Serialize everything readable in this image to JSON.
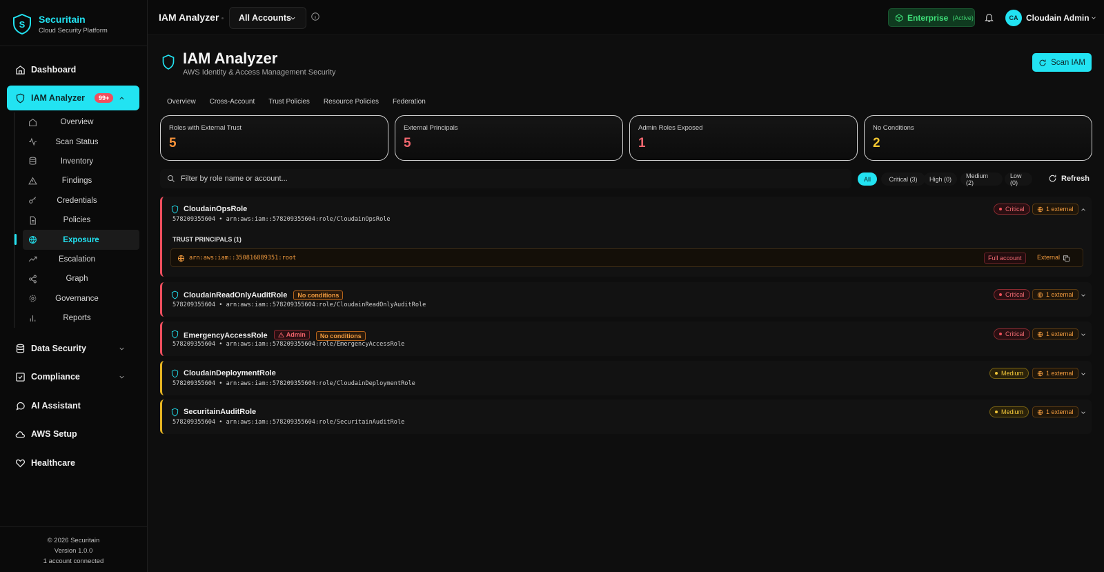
{
  "brand": {
    "name": "Securitain",
    "tagline": "Cloud Security Platform",
    "logo_letter": "S"
  },
  "sidebar": {
    "dashboard": "Dashboard",
    "iam": {
      "label": "IAM Analyzer",
      "badge": "99+"
    },
    "sub_items": [
      {
        "label": "Overview",
        "icon": "home-icon"
      },
      {
        "label": "Scan Status",
        "icon": "activity-icon"
      },
      {
        "label": "Inventory",
        "icon": "database-icon"
      },
      {
        "label": "Findings",
        "icon": "alert-triangle-icon"
      },
      {
        "label": "Credentials",
        "icon": "key-icon"
      },
      {
        "label": "Policies",
        "icon": "file-icon"
      },
      {
        "label": "Exposure",
        "icon": "globe-icon",
        "active": true
      },
      {
        "label": "Escalation",
        "icon": "trending-up-icon"
      },
      {
        "label": "Graph",
        "icon": "share-icon"
      },
      {
        "label": "Governance",
        "icon": "gear-icon"
      },
      {
        "label": "Reports",
        "icon": "bar-chart-icon"
      }
    ],
    "data_security": "Data Security",
    "compliance": "Compliance",
    "ai_assistant": "AI Assistant",
    "aws_setup": "AWS Setup",
    "healthcare": "Healthcare",
    "footer": {
      "copyright": "© 2026 Securitain",
      "version": "Version 1.0.0",
      "accounts": "1 account connected"
    }
  },
  "topbar": {
    "title": "IAM Analyzer",
    "account_select": "All Accounts",
    "plan": "Enterprise",
    "plan_status": "(Active)",
    "avatar_initials": "CA",
    "user_name": "Cloudain Admin"
  },
  "page": {
    "title": "IAM Analyzer",
    "subtitle": "AWS Identity & Access Management Security",
    "scan_button": "Scan IAM",
    "tabs": [
      "Overview",
      "Cross-Account",
      "Trust Policies",
      "Resource Policies",
      "Federation"
    ]
  },
  "stats": [
    {
      "label": "Roles with External Trust",
      "value": "5",
      "color": "#f7923a"
    },
    {
      "label": "External Principals",
      "value": "5",
      "color": "#f3676f"
    },
    {
      "label": "Admin Roles Exposed",
      "value": "1",
      "color": "#f3676f"
    },
    {
      "label": "No Conditions",
      "value": "2",
      "color": "#f3c630"
    }
  ],
  "filter": {
    "placeholder": "Filter by role name or account...",
    "pills": [
      "All",
      "Critical (3)",
      "High (0)",
      "Medium (2)",
      "Low (0)"
    ],
    "refresh": "Refresh"
  },
  "roles": [
    {
      "name": "CloudainOpsRole",
      "arn_line": "578209355604 • arn:aws:iam::578209355604:role/CloudainOpsRole",
      "severity": "Critical",
      "external": "1 external",
      "expanded": true,
      "trust_title": "TRUST PRINCIPALS (1)",
      "principal": "arn:aws:iam::350816889351:root",
      "full_account": "Full account",
      "external_label": "External"
    },
    {
      "name": "CloudainReadOnlyAuditRole",
      "tag_no_conditions": "No conditions",
      "arn_line": "578209355604 • arn:aws:iam::578209355604:role/CloudainReadOnlyAuditRole",
      "severity": "Critical",
      "external": "1 external"
    },
    {
      "name": "EmergencyAccessRole",
      "tag_admin": "Admin",
      "tag_no_conditions": "No conditions",
      "arn_line": "578209355604 • arn:aws:iam::578209355604:role/EmergencyAccessRole",
      "severity": "Critical",
      "external": "1 external"
    },
    {
      "name": "CloudainDeploymentRole",
      "arn_line": "578209355604 • arn:aws:iam::578209355604:role/CloudainDeploymentRole",
      "severity": "Medium",
      "external": "1 external"
    },
    {
      "name": "SecuritainAuditRole",
      "arn_line": "578209355604 • arn:aws:iam::578209355604:role/SecuritainAuditRole",
      "severity": "Medium",
      "external": "1 external"
    }
  ],
  "colors": {
    "accent": "#22e3f2",
    "critical": "#ef4f5f",
    "medium": "#e6b422",
    "external": "#f09a3e"
  }
}
